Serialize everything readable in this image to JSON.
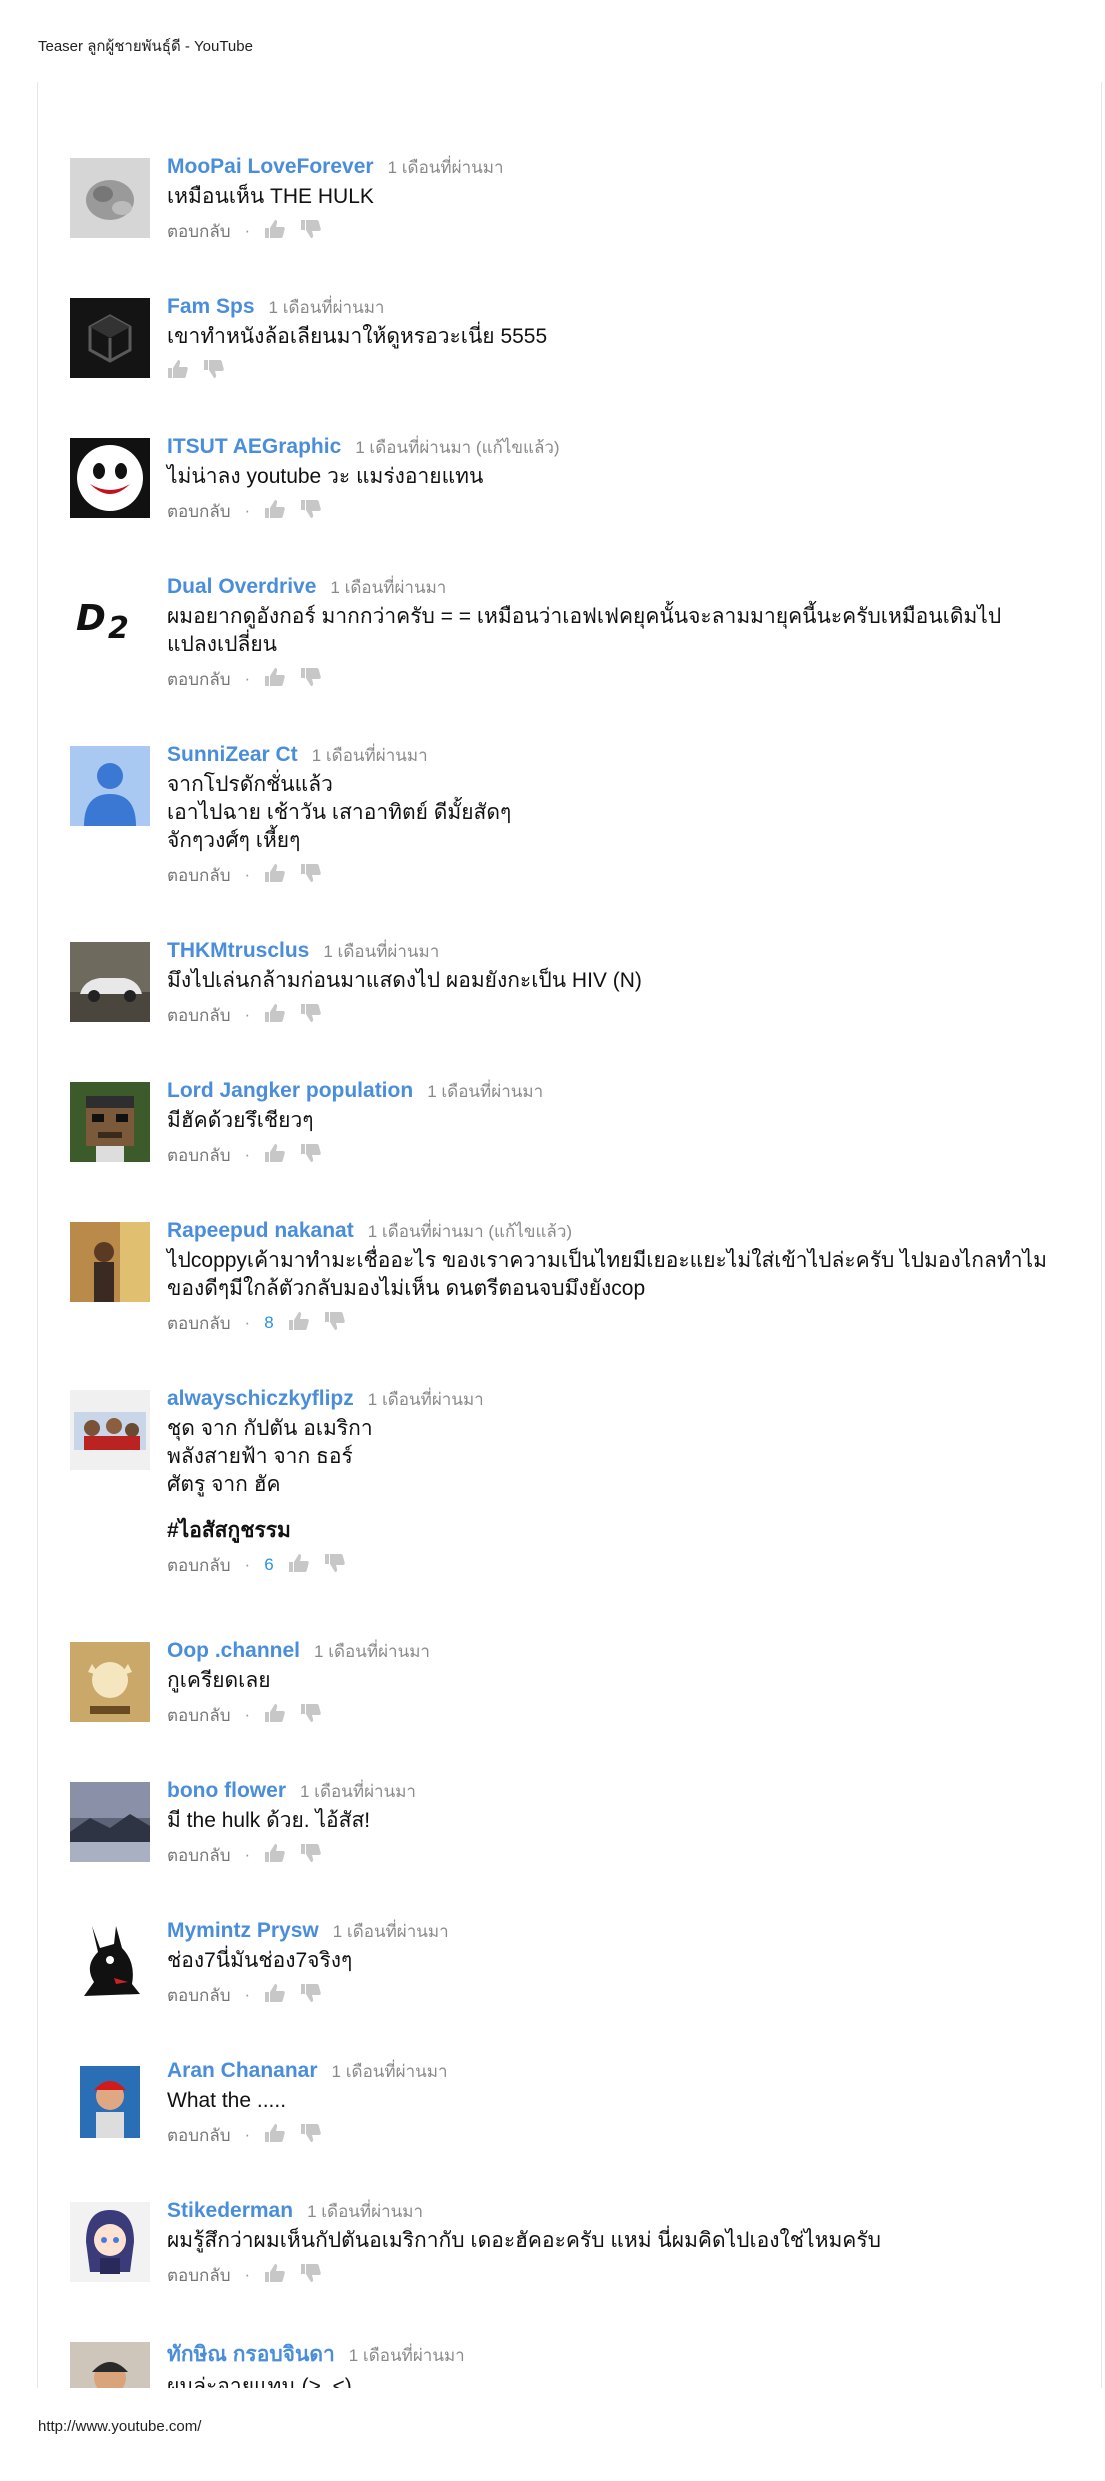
{
  "page_title": "Teaser ลูกผู้ชายพันธุ์ดี - YouTube",
  "url": "http://www.youtube.com/",
  "labels": {
    "reply": "ตอบกลับ",
    "separator": "·"
  },
  "comments": [
    {
      "author": "",
      "time": "",
      "text": [],
      "likes": "",
      "avatar": "none"
    },
    {
      "author": "MooPai LoveForever",
      "time": "1 เดือนที่ผ่านมา",
      "text": [
        "เหมือนเห็น  THE HULK"
      ],
      "likes": "",
      "avatar": "grey-blur"
    },
    {
      "author": "Fam Sps",
      "time": "1 เดือนที่ผ่านมา",
      "text": [
        "เขาทำหนังล้อเลียนมาให้ดูหรอวะเนี่ย 5555"
      ],
      "likes": "",
      "avatar": "dark-cube",
      "no_reply": true
    },
    {
      "author": "ITSUT AEGraphic",
      "time": "1 เดือนที่ผ่านมา (แก้ไขแล้ว)",
      "text": [
        "ไม่น่าลง youtube  วะ แมร่งอายแทน"
      ],
      "likes": "",
      "avatar": "joker-face"
    },
    {
      "author": "Dual Overdrive",
      "time": "1 เดือนที่ผ่านมา",
      "text": [
        "ผมอยากดูอังกอร์ มากกว่าครับ = = เหมือนว่าเอฟเฟคยุคนั้นจะลามมายุคนี้นะครับเหมือนเดิมไป",
        "แปลงเปลี่ยน"
      ],
      "likes": "",
      "avatar": "d2-logo"
    },
    {
      "author": "SunniZear Ct",
      "time": "1 เดือนที่ผ่านมา",
      "text": [
        "จากโปรดักชั่นแล้ว",
        "เอาไปฉาย เช้าวัน เสาอาทิตย์ ดีมั้ยสัดๆ",
        "จักๆวงศ์ๆ เหี้ยๆ"
      ],
      "likes": "",
      "avatar": "default-user"
    },
    {
      "author": "THKMtrusclus",
      "time": "1 เดือนที่ผ่านมา",
      "text": [
        "มึงไปเล่นกล้ามก่อนมาแสดงไป ผอมยังกะเป็น HIV (N)"
      ],
      "likes": "",
      "avatar": "car-photo"
    },
    {
      "author": "Lord Jangker population",
      "time": "1 เดือนที่ผ่านมา",
      "text": [
        "มีฮัคด้วยรึเชียวๆ"
      ],
      "likes": "",
      "avatar": "pixel-face"
    },
    {
      "author": "Rapeepud nakanat",
      "time": "1 เดือนที่ผ่านมา (แก้ไขแล้ว)",
      "text": [
        "ไปcoppyเค้ามาทำมะเชื่ออะไร ของเราความเป็นไทยมีเยอะแยะไม่ใส่เข้าไปล่ะครับ ไปมองไกลทำไม",
        "ของดีๆมีใกล้ตัวกลับมองไม่เห็น ดนตรีตอนจบมึงยังcop"
      ],
      "likes": "8",
      "avatar": "person-photo"
    },
    {
      "author": "alwayschiczkyflipz",
      "time": "1 เดือนที่ผ่านมา",
      "text": [
        "ชุด จาก กัปตัน อเมริกา",
        "พลังสายฟ้า จาก ธอร์",
        "ศัตรู จาก ฮัค"
      ],
      "hashtag": "#ไอสัสกูชรรม",
      "likes": "6",
      "avatar": "group-photo"
    },
    {
      "author": "Oop .channel",
      "time": "1 เดือนที่ผ่านมา",
      "text": [
        "กูเครียดเลย"
      ],
      "likes": "",
      "avatar": "oop-logo"
    },
    {
      "author": "bono flower",
      "time": "1 เดือนที่ผ่านมา",
      "text": [
        "มี the hulk ด้วย. ไอ้สัส!"
      ],
      "likes": "",
      "avatar": "landscape"
    },
    {
      "author": "Mymintz Prysw",
      "time": "1 เดือนที่ผ่านมา",
      "text": [
        "ช่อง7นี่มันช่อง7จริงๆ"
      ],
      "likes": "",
      "avatar": "black-figure"
    },
    {
      "author": "Aran Chananar",
      "time": "1 เดือนที่ผ่านมา",
      "text": [
        "What the ....."
      ],
      "likes": "",
      "avatar": "red-cap"
    },
    {
      "author": "Stikederman",
      "time": "1 เดือนที่ผ่านมา",
      "text": [
        "ผมรู้สึกว่าผมเห็นกัปตันอเมริกากับ เดอะฮัคอะครับ แหม่ นี่ผมคิดไปเองใช่ไหมครับ"
      ],
      "likes": "",
      "avatar": "anime-girl"
    },
    {
      "author": "ทักษิณ กรอบจินดา",
      "time": "1 เดือนที่ผ่านมา",
      "text": [
        "ผมล่ะอายแทน (>_<)"
      ],
      "likes": "",
      "avatar": "selfie"
    }
  ]
}
